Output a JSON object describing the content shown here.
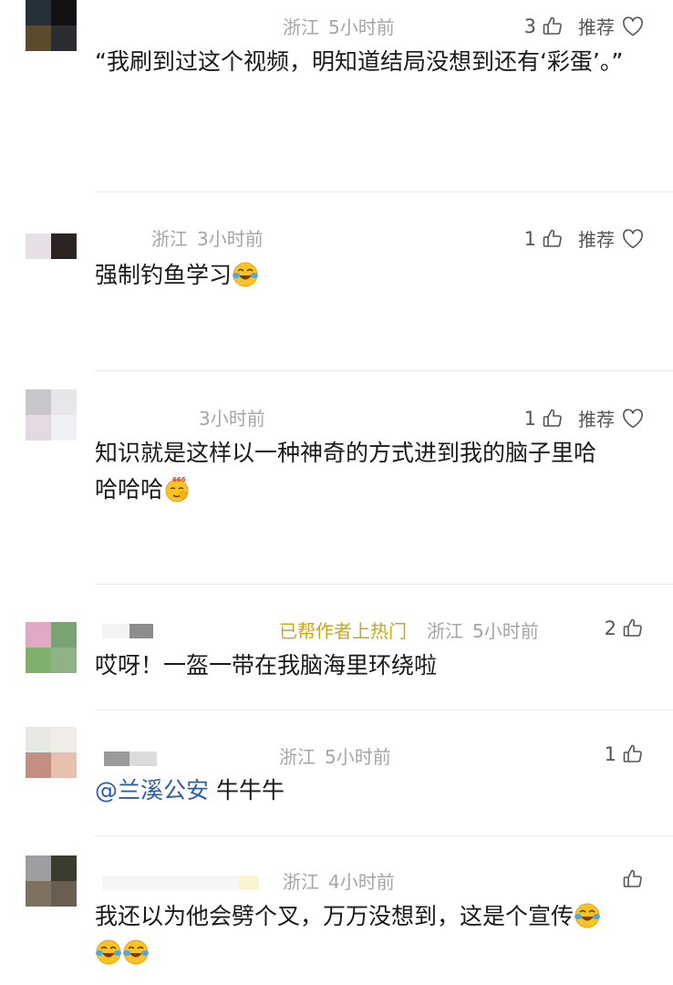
{
  "comments": [
    {
      "location": "浙江",
      "time": "5小时前",
      "likes": "3",
      "recommend": "推荐",
      "text": "“我刷到过这个视频，明知道结局没想到还有‘彩蛋’。”"
    },
    {
      "location": "浙江",
      "time": "3小时前",
      "likes": "1",
      "recommend": "推荐",
      "text": "强制钓鱼学习"
    },
    {
      "location": "",
      "time": "3小时前",
      "likes": "1",
      "recommend": "推荐",
      "text_line1": "知识就是这样以一种神奇的方式进到我的脑子里哈",
      "text_line2": "哈哈哈"
    },
    {
      "hot_badge": "已帮作者上热门",
      "location": "浙江",
      "time": "5小时前",
      "likes": "2",
      "text": "哎呀！一盔一带在我脑海里环绕啦"
    },
    {
      "location": "浙江",
      "time": "5小时前",
      "likes": "1",
      "mention": "@兰溪公安",
      "text": "牛牛牛"
    },
    {
      "location": "浙江",
      "time": "4小时前",
      "likes": "",
      "text": "我还以为他会劈个叉，万万没想到，这是个宣传"
    }
  ],
  "icons": {
    "thumb": "thumbs-up-icon",
    "heart": "heart-icon",
    "emoji_cry_laugh": "crying-laughing-emoji",
    "emoji_666": "666-emoji"
  }
}
